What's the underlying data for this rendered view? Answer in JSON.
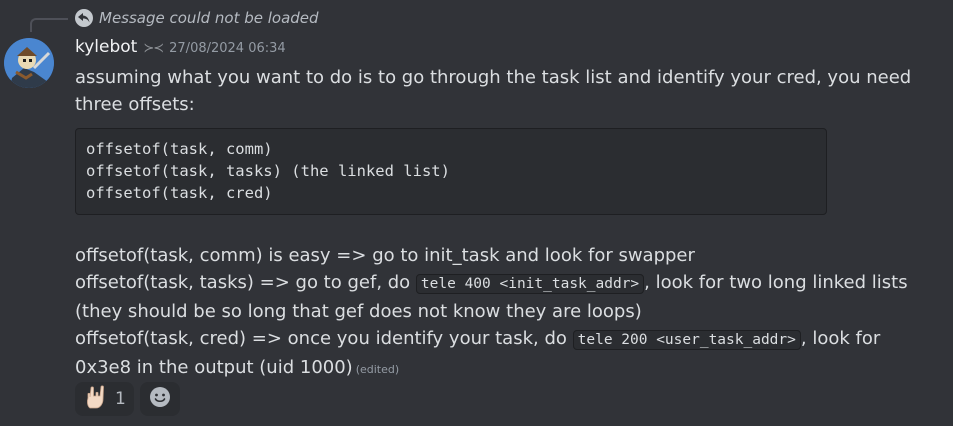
{
  "reply": {
    "text": "Message could not be loaded",
    "icon": "reply-arrow-icon"
  },
  "message": {
    "author": "kylebot",
    "author_tag_glyph": "≻≺",
    "timestamp": "27/08/2024 06:34",
    "avatar_icon": "bot-avatar-image",
    "intro": "assuming what you want to do is to go through the task list and identify your cred, you need three offsets:",
    "code_lines": [
      "offsetof(task, comm)",
      "offsetof(task, tasks) (the linked list)",
      "offsetof(task, cred)"
    ],
    "line1": "offsetof(task, comm) is easy => go to init_task and look for swapper",
    "line2_before": "offsetof(task, tasks) => go to gef, do ",
    "line2_code": "tele 400 <init_task_addr>",
    "line2_after": ", look for two long linked lists",
    "line3": "(they should be so long that gef does not know they are loops)",
    "line4_before": "offsetof(task, cred) => once you identify your task, do ",
    "line4_code": "tele 200 <user_task_addr>",
    "line4_after": ", look for",
    "line5": "0x3e8 in the output (uid 1000)",
    "edited_label": "(edited)"
  },
  "reactions": [
    {
      "emoji": "rock-hand-emoji",
      "count": "1"
    }
  ],
  "add_reaction_icon": "smiley-face-icon",
  "colors": {
    "background": "#313338",
    "code_background": "#2b2d31",
    "text": "#dbdee1",
    "muted": "#949ba4"
  }
}
